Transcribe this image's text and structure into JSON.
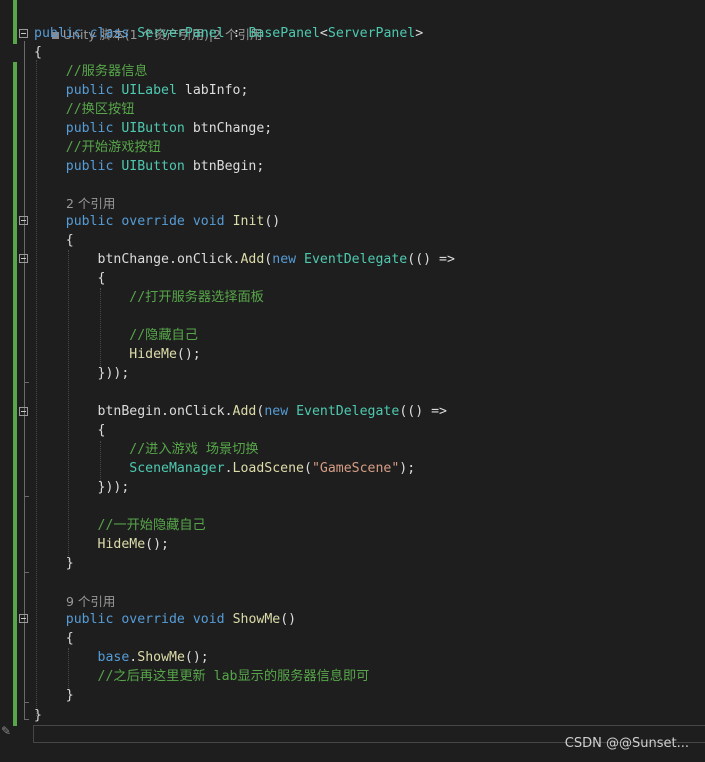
{
  "class_lens": {
    "text": "Unity 脚本(1 个资产引用)|2 个引用"
  },
  "code": {
    "l1": [
      "public",
      "class",
      "ServerPanel",
      ":",
      "BasePanel",
      "<",
      "ServerPanel",
      ">"
    ],
    "brace_open": "{",
    "brace_close": "}",
    "c_info": "//服务器信息",
    "labinfo": [
      "public",
      "UILabel",
      "labInfo;"
    ],
    "c_change": "//换区按钮",
    "btnchange_decl": [
      "public",
      "UIButton",
      "btnChange;"
    ],
    "c_begin": "//开始游戏按钮",
    "btnbegin_decl": [
      "public",
      "UIButton",
      "btnBegin;"
    ],
    "init_refs": "2 个引用",
    "init_sig": [
      "public",
      "override",
      "void",
      "Init",
      "()"
    ],
    "change_click": [
      "btnChange.",
      "onClick.",
      "Add",
      "(",
      "new",
      "EventDelegate",
      "(() =>"
    ],
    "c_open": "//打开服务器选择面板",
    "c_hide": "//隐藏自己",
    "hideme_call": [
      "HideMe",
      "();"
    ],
    "close_lambda": "}));",
    "begin_click": [
      "btnBegin.",
      "onClick.",
      "Add",
      "(",
      "new",
      "EventDelegate",
      "(() =>"
    ],
    "c_enter": "//进入游戏 场景切换",
    "scene_load": [
      "SceneManager",
      ".",
      "LoadScene",
      "(",
      "\"GameScene\"",
      ");"
    ],
    "c_first_hide": "//一开始隐藏自己",
    "showme_refs": "9 个引用",
    "showme_sig": [
      "public",
      "override",
      "void",
      "ShowMe",
      "()"
    ],
    "base_call": [
      "base",
      ".",
      "ShowMe",
      "();"
    ],
    "c_later": "//之后再这里更新 lab显示的服务器信息即可"
  },
  "watermark": "CSDN @@Sunset...",
  "colors": {
    "background": "#1e1e1e",
    "keyword": "#569cd6",
    "type": "#4ec9b0",
    "comment": "#57a64a",
    "string": "#d69d85",
    "method": "#dcdcaa",
    "text": "#dcdcdc",
    "lens": "#999999"
  }
}
